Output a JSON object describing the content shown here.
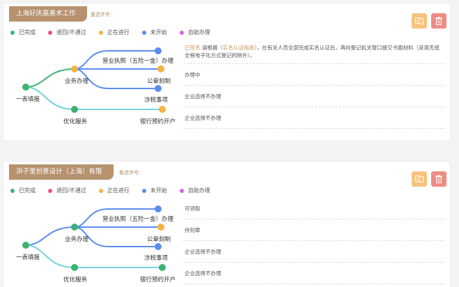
{
  "legend": [
    {
      "label": "已完成",
      "color": "#3cb371"
    },
    {
      "label": "退回/不通过",
      "color": "#f0506e"
    },
    {
      "label": "正在进行",
      "color": "#f5b342"
    },
    {
      "label": "未开始",
      "color": "#5b8def"
    },
    {
      "label": "自助办理",
      "color": "#d46be0"
    }
  ],
  "cards": [
    {
      "company": "上海好庆嘉美术工作室",
      "memo_label": "备选字号：",
      "flow": {
        "root": "一表填报",
        "business": "业务办理",
        "license": "营业执照（五险一金）办理",
        "seal": "公章刻制",
        "tax": "涉税事项",
        "optimize": "优化服务",
        "bank": "银行预约开户"
      },
      "status": {
        "row1_prefix": "已签名",
        "row1_text_a": "请根据",
        "row1_link": "《实名认证指南》",
        "row1_text_b": "，在有关人员全部完成实名认证后，再向登记机关窗口提交书面材料（采用无纸全程电子化方式登记的除外）。",
        "row2": "办理中",
        "row3": "企业选择不办理",
        "row4": "企业选择不办理"
      }
    },
    {
      "company": "洪子里创意设计（上海）有限公司",
      "memo_label": "备选字号：",
      "flow": {
        "root": "一表填报",
        "business": "业务办理",
        "license": "营业执照（五险一金）办理",
        "seal": "公章刻制",
        "tax": "涉税事项",
        "optimize": "优化服务",
        "bank": "银行预约开户"
      },
      "status": {
        "row1": "可领取",
        "row2": "待刻章",
        "row3": "企业选择不办理",
        "row4": "企业选择不办理"
      }
    }
  ],
  "icons": {
    "alternate": "swap-icon",
    "delete": "trash-icon"
  }
}
